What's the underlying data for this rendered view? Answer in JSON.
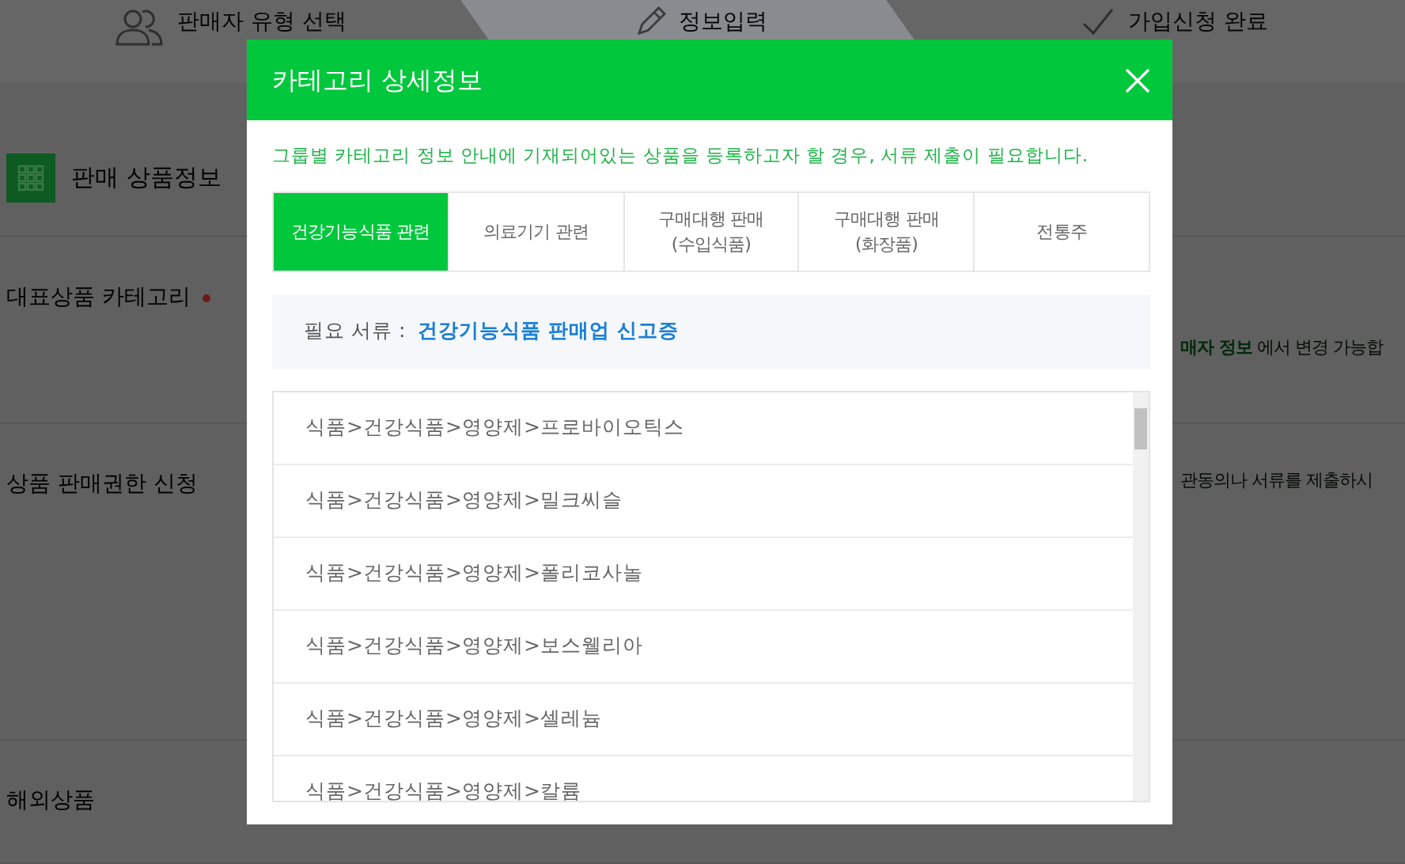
{
  "steps": [
    {
      "label": "판매자 유형 선택",
      "kind": "people",
      "selected": false
    },
    {
      "label": "정보입력",
      "kind": "pencil",
      "selected": true
    },
    {
      "label": "가입신청 완료",
      "kind": "check",
      "selected": false
    }
  ],
  "section_title": "판매 상품정보",
  "fields": [
    {
      "label": "대표상품 카테고리",
      "required": true,
      "note_bold": "매자 정보",
      "note": "에서 변경 가능합"
    },
    {
      "label": "상품 판매권한 신청",
      "required": false,
      "note": "관동의나 서류를 제출하시"
    },
    {
      "label": "해외상품",
      "required": false
    }
  ],
  "modal": {
    "title": "카테고리 상세정보",
    "notice": "그룹별 카테고리 정보 안내에 기재되어있는 상품을 등록하고자 할 경우, 서류 제출이 필요합니다.",
    "tabs": [
      {
        "label": "건강기능식품 관련",
        "selected": true
      },
      {
        "label": "의료기기 관련",
        "selected": false
      },
      {
        "label": "구매대행 판매\n(수입식품)",
        "selected": false
      },
      {
        "label": "구매대행 판매\n(화장품)",
        "selected": false
      },
      {
        "label": "전통주",
        "selected": false
      }
    ],
    "document_label": "필요 서류 :",
    "document": "건강기능식품 판매업 신고증",
    "categories": [
      "식품>건강식품>영양제>프로바이오틱스",
      "식품>건강식품>영양제>밀크씨슬",
      "식품>건강식품>영양제>폴리코사놀",
      "식품>건강식품>영양제>보스웰리아",
      "식품>건강식품>영양제>셀레늄",
      "식품>건강식품>영양제>칼륨"
    ]
  }
}
